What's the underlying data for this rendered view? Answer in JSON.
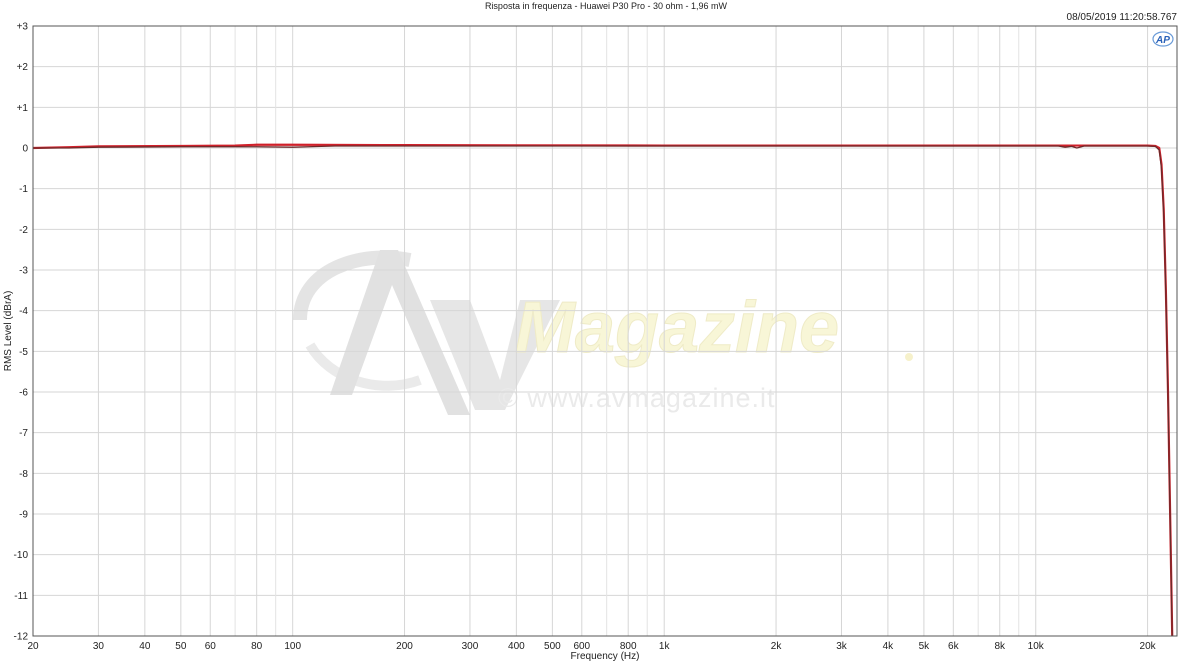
{
  "chart_data": {
    "type": "line",
    "title": "Risposta in frequenza - Huawei P30 Pro - 30 ohm - 1,96 mW",
    "timestamp": "08/05/2019 11:20:58.767",
    "brand_badge": "AP",
    "xlabel": "Frequency (Hz)",
    "ylabel": "RMS Level (dBrA)",
    "x_scale": "log",
    "xlim": [
      20,
      24000
    ],
    "ylim": [
      -12,
      3
    ],
    "grid": true,
    "x_ticks": [
      {
        "value": 20,
        "label": "20"
      },
      {
        "value": 30,
        "label": "30"
      },
      {
        "value": 40,
        "label": "40"
      },
      {
        "value": 50,
        "label": "50"
      },
      {
        "value": 60,
        "label": "60"
      },
      {
        "value": 80,
        "label": "80"
      },
      {
        "value": 100,
        "label": "100"
      },
      {
        "value": 200,
        "label": "200"
      },
      {
        "value": 300,
        "label": "300"
      },
      {
        "value": 400,
        "label": "400"
      },
      {
        "value": 500,
        "label": "500"
      },
      {
        "value": 600,
        "label": "600"
      },
      {
        "value": 800,
        "label": "800"
      },
      {
        "value": 1000,
        "label": "1k"
      },
      {
        "value": 2000,
        "label": "2k"
      },
      {
        "value": 3000,
        "label": "3k"
      },
      {
        "value": 4000,
        "label": "4k"
      },
      {
        "value": 5000,
        "label": "5k"
      },
      {
        "value": 6000,
        "label": "6k"
      },
      {
        "value": 8000,
        "label": "8k"
      },
      {
        "value": 10000,
        "label": "10k"
      },
      {
        "value": 20000,
        "label": "20k"
      }
    ],
    "x_minor": [
      70,
      90,
      700,
      900,
      7000,
      9000
    ],
    "y_ticks": [
      {
        "value": 3,
        "label": "+3"
      },
      {
        "value": 2,
        "label": "+2"
      },
      {
        "value": 1,
        "label": "+1"
      },
      {
        "value": 0,
        "label": "0"
      },
      {
        "value": -1,
        "label": "-1"
      },
      {
        "value": -2,
        "label": "-2"
      },
      {
        "value": -3,
        "label": "-3"
      },
      {
        "value": -4,
        "label": "-4"
      },
      {
        "value": -5,
        "label": "-5"
      },
      {
        "value": -6,
        "label": "-6"
      },
      {
        "value": -7,
        "label": "-7"
      },
      {
        "value": -8,
        "label": "-8"
      },
      {
        "value": -9,
        "label": "-9"
      },
      {
        "value": -10,
        "label": "-10"
      },
      {
        "value": -11,
        "label": "-11"
      },
      {
        "value": -12,
        "label": "-12"
      }
    ],
    "series": [
      {
        "color": "#d0202a",
        "points": [
          [
            20,
            0.0
          ],
          [
            25,
            0.02
          ],
          [
            30,
            0.04
          ],
          [
            50,
            0.05
          ],
          [
            70,
            0.06
          ],
          [
            80,
            0.08
          ],
          [
            100,
            0.08
          ],
          [
            200,
            0.07
          ],
          [
            1000,
            0.06
          ],
          [
            5000,
            0.06
          ],
          [
            10000,
            0.06
          ],
          [
            15000,
            0.06
          ],
          [
            20000,
            0.06
          ],
          [
            21000,
            0.05
          ],
          [
            21500,
            0.0
          ],
          [
            21800,
            -0.4
          ],
          [
            22100,
            -1.5
          ],
          [
            22400,
            -3.5
          ],
          [
            22700,
            -6.0
          ],
          [
            23000,
            -9.0
          ],
          [
            23300,
            -12.0
          ]
        ]
      },
      {
        "color": "#6b2a2a",
        "points": [
          [
            20,
            0.0
          ],
          [
            25,
            0.0
          ],
          [
            30,
            0.02
          ],
          [
            50,
            0.03
          ],
          [
            80,
            0.03
          ],
          [
            100,
            0.02
          ],
          [
            110,
            0.03
          ],
          [
            130,
            0.05
          ],
          [
            1000,
            0.05
          ],
          [
            5000,
            0.05
          ],
          [
            11500,
            0.05
          ],
          [
            12000,
            0.02
          ],
          [
            12500,
            0.04
          ],
          [
            12900,
            0.0
          ],
          [
            13500,
            0.05
          ],
          [
            20000,
            0.05
          ],
          [
            21000,
            0.04
          ],
          [
            21500,
            -0.05
          ],
          [
            21800,
            -0.5
          ],
          [
            22100,
            -1.6
          ],
          [
            22400,
            -3.6
          ],
          [
            22700,
            -6.1
          ],
          [
            23000,
            -9.1
          ],
          [
            23300,
            -12.0
          ]
        ]
      }
    ],
    "watermark": {
      "brand": "Magazine",
      "url": "© www.avmagazine.it"
    }
  }
}
